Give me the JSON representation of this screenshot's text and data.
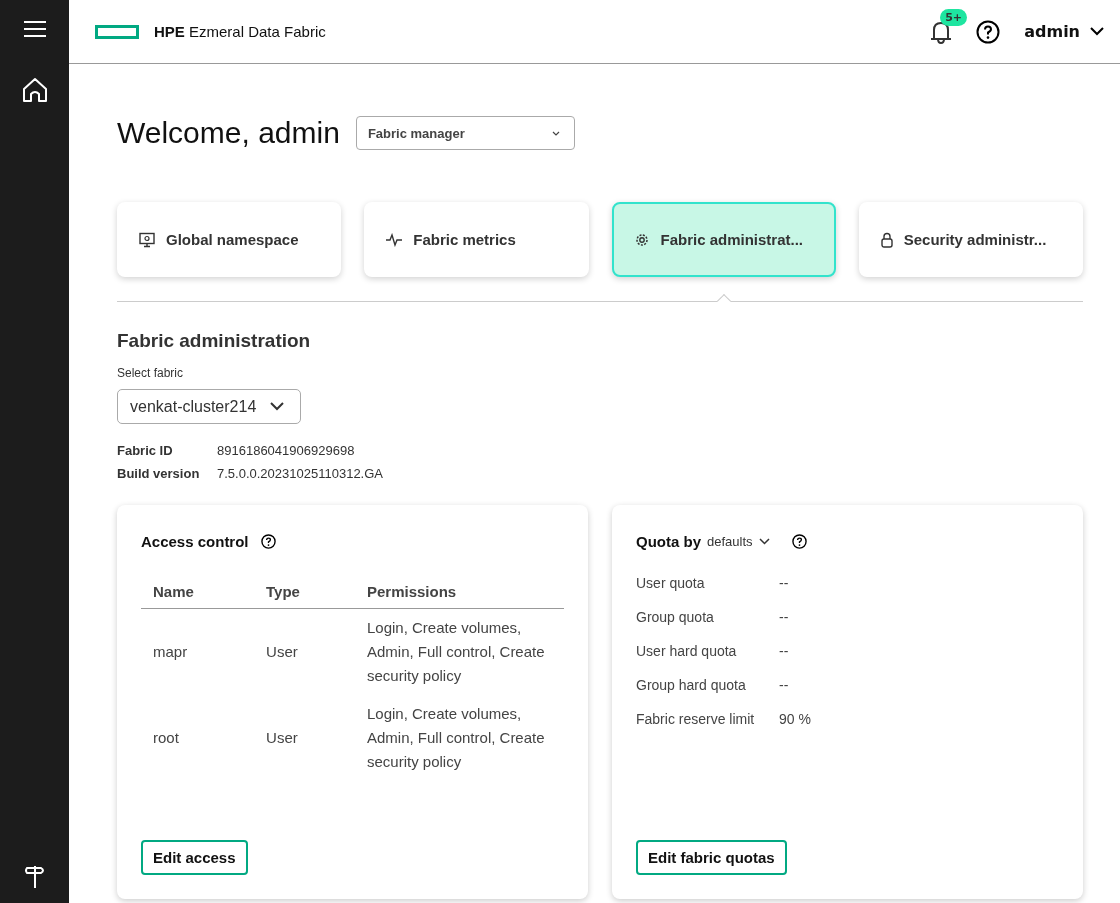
{
  "header": {
    "brand_bold": "HPE",
    "brand": "Ezmeral Data Fabric",
    "notification_badge": "5+",
    "user": "admin"
  },
  "welcome": {
    "title": "Welcome, admin",
    "view_select": "Fabric manager"
  },
  "tabs": [
    {
      "label": "Global namespace",
      "kind": "monitor",
      "selected": false
    },
    {
      "label": "Fabric metrics",
      "kind": "pulse",
      "selected": false
    },
    {
      "label": "Fabric administrat...",
      "kind": "gear",
      "selected": true
    },
    {
      "label": "Security administr...",
      "kind": "lock",
      "selected": false
    }
  ],
  "section": {
    "title": "Fabric administration",
    "select_label": "Select fabric",
    "fabric": "venkat-cluster214",
    "details": [
      {
        "label": "Fabric ID",
        "value": "8916186041906929698"
      },
      {
        "label": "Build version",
        "value": "7.5.0.0.20231025110312.GA"
      }
    ]
  },
  "access_control": {
    "title": "Access control",
    "columns": [
      "Name",
      "Type",
      "Permissions"
    ],
    "rows": [
      {
        "name": "mapr",
        "type": "User",
        "permissions": "Login, Create volumes, Admin, Full control, Create security policy"
      },
      {
        "name": "root",
        "type": "User",
        "permissions": "Login, Create volumes, Admin, Full control, Create security policy"
      }
    ],
    "button": "Edit access"
  },
  "quota": {
    "title": "Quota by",
    "select": "defaults",
    "rows": [
      {
        "label": "User quota",
        "value": "--"
      },
      {
        "label": "Group quota",
        "value": "--"
      },
      {
        "label": "User hard quota",
        "value": "--"
      },
      {
        "label": "Group hard quota",
        "value": "--"
      },
      {
        "label": "Fabric reserve limit",
        "value": "90 %"
      }
    ],
    "button": "Edit fabric quotas"
  }
}
